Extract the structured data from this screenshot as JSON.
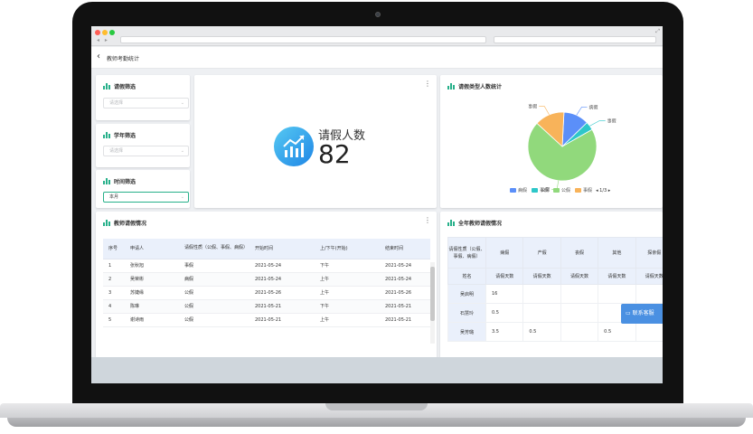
{
  "page": {
    "title": "教师考勤统计"
  },
  "filters": [
    {
      "title": "请假筛选",
      "placeholder": "请选择",
      "value": ""
    },
    {
      "title": "学年筛选",
      "placeholder": "请选择",
      "value": ""
    },
    {
      "title": "时间筛选",
      "placeholder": "",
      "value": "本月"
    }
  ],
  "kpi": {
    "label": "请假人数",
    "value": "82"
  },
  "pie": {
    "title": "请假类型人数统计",
    "chart_data": {
      "type": "pie",
      "labels": [
        "病假",
        "事假",
        "公假",
        "事假"
      ],
      "values": [
        12,
        4,
        70,
        14
      ],
      "colors": [
        "#5b8ff9",
        "#2ec7c9",
        "#91d97c",
        "#f8b35a"
      ],
      "legend_position": "bottom"
    },
    "slice_labels": [
      "病假",
      "事假",
      "公假",
      "事假"
    ],
    "legend": [
      {
        "name": "病假",
        "color": "#5b8ff9"
      },
      {
        "name": "事假",
        "color": "#2ec7c9"
      },
      {
        "name": "公假",
        "color": "#91d97c"
      },
      {
        "name": "事假",
        "color": "#f8b35a"
      }
    ],
    "pager": "1/3"
  },
  "leave_table": {
    "title": "教师请假情况",
    "headers": [
      "序号",
      "申请人",
      "请假性质（公假、事假、病假）",
      "开始时间",
      "上/下午(开始)",
      "结束时间"
    ],
    "rows": [
      [
        "1",
        "张秋旭",
        "事假",
        "2021-05-24",
        "下午",
        "2021-05-24"
      ],
      [
        "2",
        "吴荣彬",
        "病假",
        "2021-05-24",
        "上午",
        "2021-05-24"
      ],
      [
        "3",
        "苏婕缘",
        "公假",
        "2021-05-26",
        "上午",
        "2021-05-26"
      ],
      [
        "4",
        "陈琳",
        "公假",
        "2021-05-21",
        "下午",
        "2021-05-21"
      ],
      [
        "5",
        "谢诗雨",
        "公假",
        "2021-05-21",
        "上午",
        "2021-05-21"
      ]
    ]
  },
  "year_table": {
    "title": "全年教师请假情况",
    "header_type": "请假性质（公假、事假、病假）",
    "types": [
      "病假",
      "产假",
      "丧假",
      "其他",
      "探亲假"
    ],
    "sub_header_name": "姓名",
    "sub_header_days": "请假天数",
    "rows": [
      {
        "name": "吴启明",
        "cells": [
          "16",
          "",
          "",
          "",
          ""
        ]
      },
      {
        "name": "石慧玲",
        "cells": [
          "0.5",
          "",
          "",
          "",
          ""
        ]
      },
      {
        "name": "吴芳璐",
        "cells": [
          "3.5",
          "0.5",
          "",
          "0.5",
          ""
        ]
      }
    ]
  },
  "chat": {
    "label": "联系客服"
  },
  "browser": {
    "url": "",
    "search": ""
  }
}
